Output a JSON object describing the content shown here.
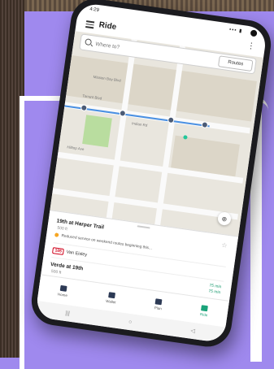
{
  "status": {
    "time": "4:29",
    "icons": "▪▪▪ ▮"
  },
  "header": {
    "title": "Ride",
    "more": "⋮"
  },
  "search": {
    "placeholder": "Where to?",
    "routes_label": "Routes"
  },
  "map": {
    "streets": [
      "Mission Bay Blvd",
      "Tarrant Blvd",
      "Indian Rd",
      "Hilltop Ave"
    ],
    "locate_icon": "⊕"
  },
  "sheet": {
    "stop1": {
      "title": "19th at Harper Trail",
      "distance": "500 ft",
      "star": "☆"
    },
    "alert": "Reduced service on weekend routes beginning this...",
    "route": {
      "badge": "105",
      "label": "Van Eisley"
    },
    "stop2": {
      "title": "Verde at 19th",
      "distance": "500 ft",
      "eta1": "75 min",
      "eta2": "75 min"
    }
  },
  "nav": [
    {
      "label": "Home"
    },
    {
      "label": "Wallet"
    },
    {
      "label": "Plan"
    },
    {
      "label": "Ride"
    }
  ],
  "sysnav": {
    "back": "◁",
    "home": "○",
    "recent": "|||"
  },
  "colors": {
    "accent": "#1aa37a",
    "background": "#9f89ee",
    "alert": "#f5a623",
    "route_badge": "#d0021b"
  }
}
